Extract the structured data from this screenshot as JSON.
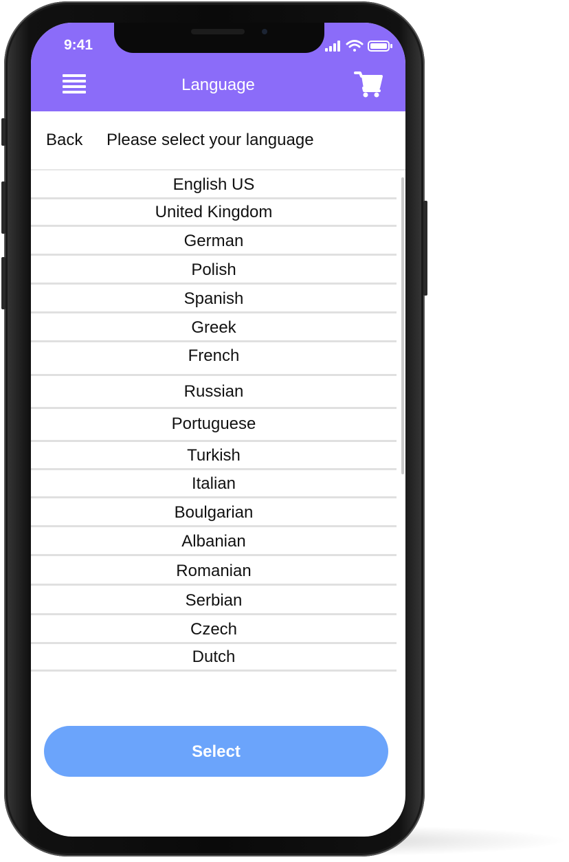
{
  "status_bar": {
    "time": "9:41"
  },
  "header": {
    "title": "Language",
    "menu_icon": "hamburger-menu-icon",
    "cart_icon": "shopping-cart-icon",
    "background_color": "#8b6cf9"
  },
  "subheader": {
    "back_label": "Back",
    "prompt": "Please select your language"
  },
  "languages": [
    "English US",
    "United Kingdom",
    "German",
    "Polish",
    "Spanish",
    "Greek",
    "French",
    "Russian",
    "Portuguese",
    "Turkish",
    "Italian",
    "Boulgarian",
    "Albanian",
    "Romanian",
    "Serbian",
    "Czech",
    "Dutch"
  ],
  "footer": {
    "select_label": "Select",
    "button_color": "#6ba4fb"
  }
}
